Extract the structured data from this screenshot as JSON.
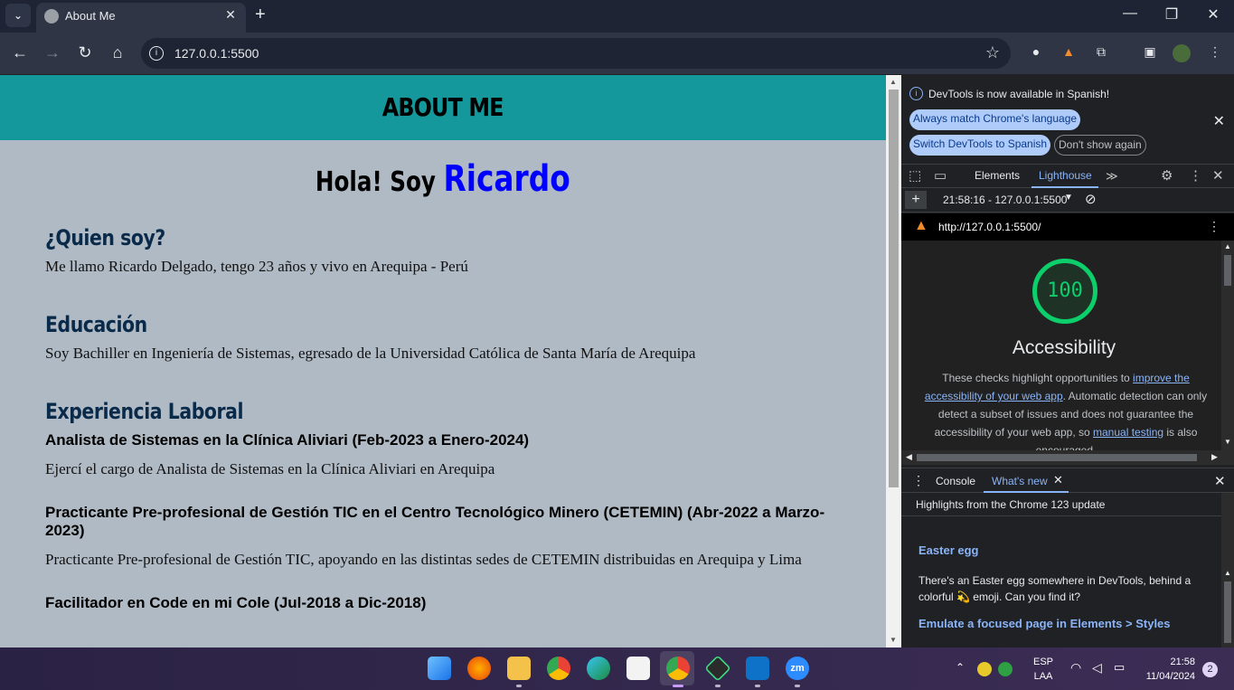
{
  "browser": {
    "tab_title": "About Me",
    "url": "127.0.0.1:5500"
  },
  "page": {
    "header": "ABOUT ME",
    "greeting_prefix": "Hola! Soy",
    "greeting_name": "Ricardo",
    "sections": [
      {
        "heading": "¿Quien soy?",
        "text": "Me llamo Ricardo Delgado, tengo 23 años y vivo en Arequipa - Perú"
      },
      {
        "heading": "Educación",
        "text": "Soy Bachiller en Ingeniería de Sistemas, egresado de la Universidad Católica de Santa María de Arequipa"
      }
    ],
    "experience_heading": "Experiencia Laboral",
    "jobs": [
      {
        "title": "Analista de Sistemas en la Clínica Aliviari (Feb-2023 a Enero-2024)",
        "text": "Ejercí el cargo de Analista de Sistemas en la Clínica Aliviari en Arequipa"
      },
      {
        "title": "Practicante Pre-profesional de Gestión TIC en el Centro Tecnológico Minero (CETEMIN) (Abr-2022 a Marzo-2023)",
        "text": "Practicante Pre-profesional de Gestión TIC, apoyando en las distintas sedes de CETEMIN distribuidas en Arequipa y Lima"
      },
      {
        "title": "Facilitador en Code en mi Cole (Jul-2018 a Dic-2018)",
        "text": ""
      }
    ]
  },
  "devtools": {
    "notice": "DevTools is now available in Spanish!",
    "btn_match": "Always match Chrome's language",
    "btn_switch": "Switch DevTools to Spanish",
    "btn_dont_show": "Don't show again",
    "tab_elements": "Elements",
    "tab_lighthouse": "Lighthouse",
    "report_selector": "21:58:16 - 127.0.0.1:5500",
    "report_url": "http://127.0.0.1:5500/",
    "score": "100",
    "category": "Accessibility",
    "desc_1": "These checks highlight opportunities to ",
    "desc_link1": "improve the accessibility of your web app",
    "desc_2": ". Automatic detection can only detect a subset of issues and does not guarantee the accessibility of your web app, so ",
    "desc_link2": "manual testing",
    "desc_3": " is also encouraged.",
    "drawer_console": "Console",
    "drawer_whatsnew": "What's new",
    "whatsnew_header": "Highlights from the Chrome 123 update",
    "egg_title": "Easter egg",
    "egg_text": "There's an Easter egg somewhere in DevTools, behind a colorful 💫 emoji. Can you find it?",
    "emulate_title": "Emulate a focused page in Elements > Styles"
  },
  "taskbar": {
    "lang_top": "ESP",
    "lang_bottom": "LAA",
    "time": "21:58",
    "date": "11/04/2024",
    "notifications": "2"
  }
}
